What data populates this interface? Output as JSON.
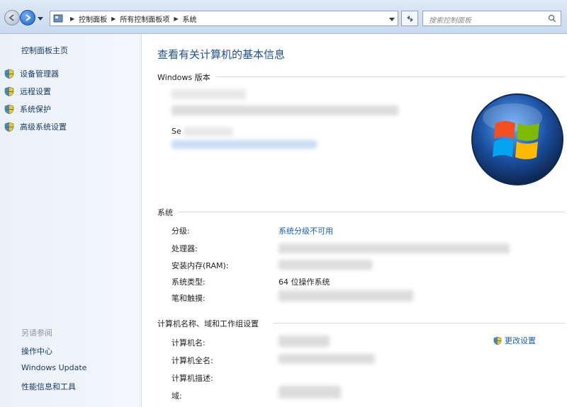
{
  "address_bar": {
    "breadcrumbs": [
      "控制面板",
      "所有控制面板项",
      "系统"
    ],
    "search_placeholder": "搜索控制面板"
  },
  "left_pane": {
    "home": "控制面板主页",
    "tasks": [
      "设备管理器",
      "远程设置",
      "系统保护",
      "高级系统设置"
    ],
    "see_also_header": "另请参阅",
    "see_also": [
      "操作中心",
      "Windows Update",
      "性能信息和工具"
    ]
  },
  "main": {
    "title": "查看有关计算机的基本信息",
    "windows_edition": {
      "header": "Windows 版本",
      "service_pack_prefix": "Se"
    },
    "system": {
      "header": "系统",
      "rating_label": "分级:",
      "rating_value": "系统分级不可用",
      "processor_label": "处理器:",
      "ram_label": "安装内存(RAM):",
      "type_label": "系统类型:",
      "type_value": "64 位操作系统",
      "pen_label": "笔和触摸:"
    },
    "computer": {
      "header": "计算机名称、域和工作组设置",
      "name_label": "计算机名:",
      "fullname_label": "计算机全名:",
      "desc_label": "计算机描述:",
      "domain_label": "域:",
      "change_settings": "更改设置"
    }
  }
}
